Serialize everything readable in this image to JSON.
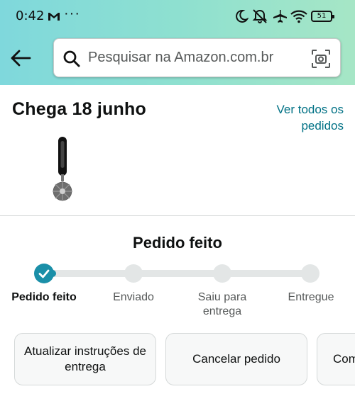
{
  "status_bar": {
    "time": "0:42",
    "battery": "51"
  },
  "header": {
    "search_placeholder": "Pesquisar na Amazon.com.br"
  },
  "order": {
    "delivery_text": "Chega 18 junho",
    "view_all_orders": "Ver todos os pedidos",
    "status_title": "Pedido feito",
    "progress": 0.04,
    "steps": [
      {
        "label": "Pedido feito",
        "done": true
      },
      {
        "label": "Enviado",
        "done": false
      },
      {
        "label": "Saiu para entrega",
        "done": false
      },
      {
        "label": "Entregue",
        "done": false
      }
    ]
  },
  "actions": {
    "update_instructions": "Atualizar instruções de entrega",
    "cancel_order": "Cancelar pedido",
    "third": "Com"
  },
  "colors": {
    "accent": "#1a8fa8",
    "link": "#007185",
    "header_gradient_start": "#7fd8dc",
    "header_gradient_end": "#a6e6c6"
  }
}
